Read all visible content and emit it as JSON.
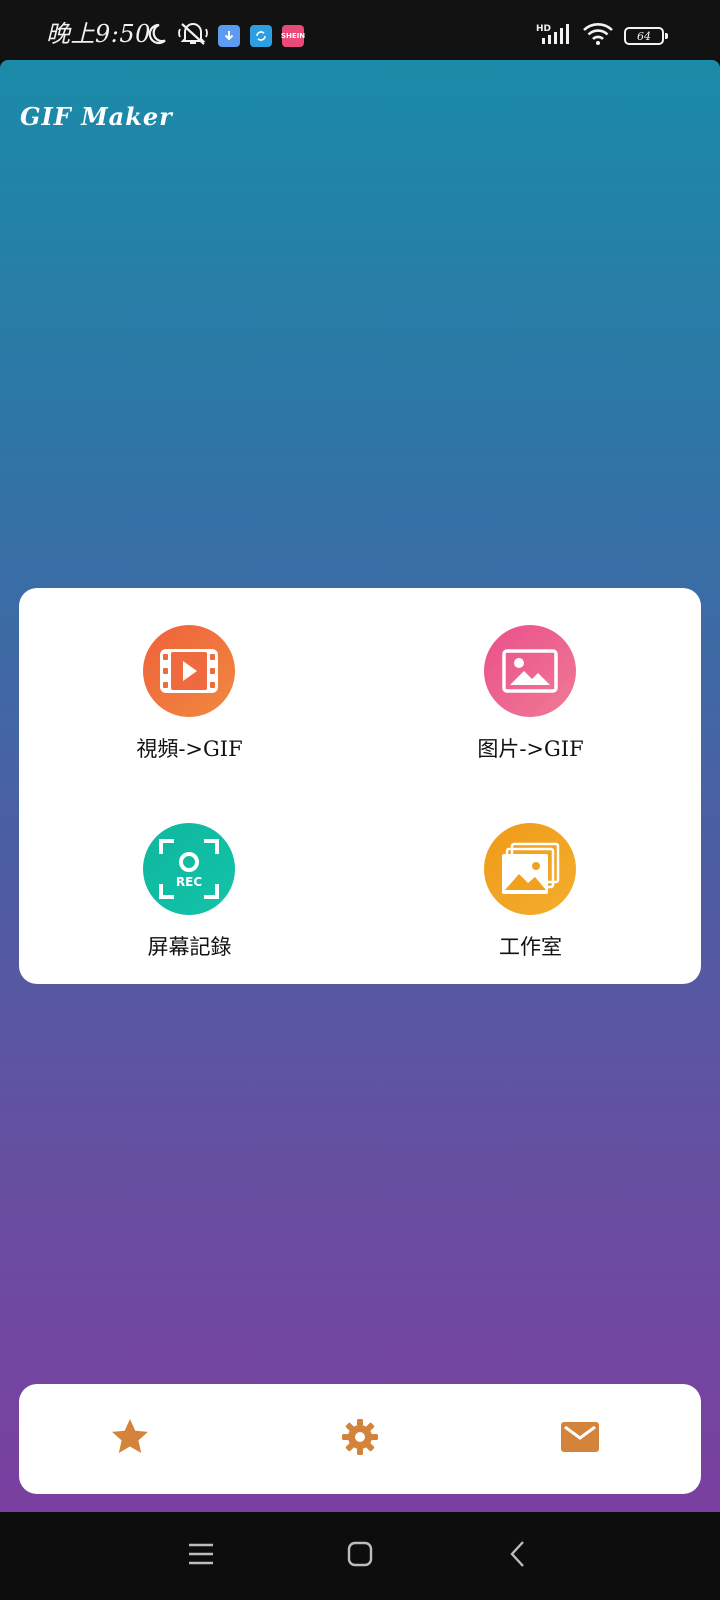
{
  "status_bar": {
    "time": "晚上9:50",
    "battery_level": "64",
    "left_icons": [
      "moon-icon",
      "mute-icon",
      "download-app-icon",
      "sync-app-icon",
      "pink-app-icon"
    ],
    "right_icons": [
      "hd-signal-icon",
      "wifi-icon",
      "battery-icon"
    ],
    "notif_label": "SHEIN"
  },
  "app": {
    "title": "GIF Maker",
    "gradient_top": "#1b8ba8",
    "gradient_bottom": "#7a3fa0"
  },
  "menu": {
    "items": [
      {
        "label": "視頻->GIF",
        "icon": "video-film-icon",
        "color": "#f26b3f"
      },
      {
        "label": "图片->GIF",
        "icon": "image-icon",
        "color": "#ec5b8c"
      },
      {
        "label": "屏幕記錄",
        "icon": "screen-record-icon",
        "icon_text": "REC",
        "color": "#10b8a0"
      },
      {
        "label": "工作室",
        "icon": "gallery-stack-icon",
        "color": "#f2a11f"
      }
    ]
  },
  "bottom_bar": {
    "accent": "#d4843a",
    "buttons": [
      "star-icon",
      "gear-icon",
      "mail-icon"
    ]
  },
  "nav_bar": {
    "buttons": [
      "menu-icon",
      "home-icon",
      "back-icon"
    ]
  }
}
